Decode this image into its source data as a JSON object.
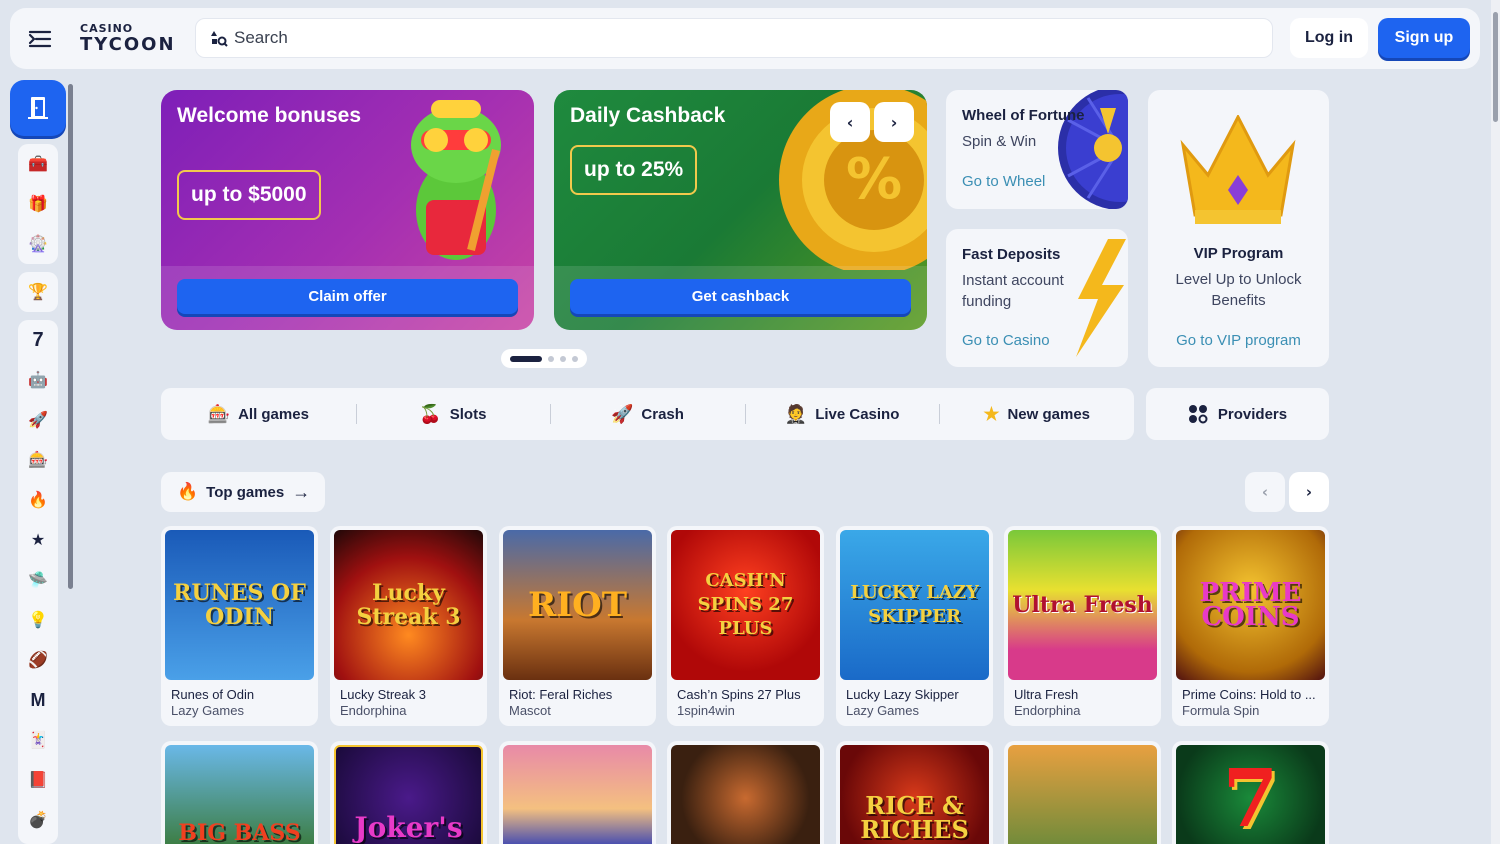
{
  "header": {
    "logo_top": "CASINO",
    "logo_bottom": "TYCOON",
    "search_placeholder": "Search",
    "login_label": "Log in",
    "signup_label": "Sign up"
  },
  "promos": {
    "welcome": {
      "title": "Welcome bonuses",
      "badge": "up to $5000",
      "button": "Claim offer"
    },
    "cashback": {
      "title": "Daily Cashback",
      "badge": "up to 25%",
      "button": "Get cashback"
    }
  },
  "side_cards": {
    "wheel": {
      "title": "Wheel of Fortune",
      "sub": "Spin & Win",
      "link": "Go to Wheel"
    },
    "deposits": {
      "title": "Fast Deposits",
      "sub": "Instant account funding",
      "link": "Go to Casino"
    },
    "vip": {
      "title": "VIP Program",
      "sub": "Level Up to Unlock Benefits",
      "link": "Go to VIP program"
    }
  },
  "categories": [
    {
      "label": "All games",
      "icon": "slot-machine-icon"
    },
    {
      "label": "Slots",
      "icon": "cherries-icon"
    },
    {
      "label": "Crash",
      "icon": "rocket-icon"
    },
    {
      "label": "Live Casino",
      "icon": "dealer-icon"
    },
    {
      "label": "New games",
      "icon": "star-icon"
    }
  ],
  "providers_label": "Providers",
  "top_games_label": "Top games",
  "games": [
    {
      "title": "Runes of Odin",
      "provider": "Lazy Games",
      "art": "RUNES OF ODIN"
    },
    {
      "title": "Lucky Streak 3",
      "provider": "Endorphina",
      "art": "Lucky Streak 3"
    },
    {
      "title": "Riot: Feral Riches",
      "provider": "Mascot",
      "art": "RIOT"
    },
    {
      "title": "Cash’n Spins 27 Plus",
      "provider": "1spin4win",
      "art": "CASH'N SPINS 27 PLUS"
    },
    {
      "title": "Lucky Lazy Skipper",
      "provider": "Lazy Games",
      "art": "LUCKY LAZY SKIPPER"
    },
    {
      "title": "Ultra Fresh",
      "provider": "Endorphina",
      "art": "Ultra Fresh"
    },
    {
      "title": "Prime Coins: Hold to ...",
      "provider": "Formula Spin",
      "art": "PRIME COINS"
    }
  ],
  "games_row2": [
    {
      "art": "BIG BASS"
    },
    {
      "art": "Joker's"
    },
    {
      "art": ""
    },
    {
      "art": ""
    },
    {
      "art": "RICE & RICHES"
    },
    {
      "art": ""
    },
    {
      "art": "7"
    }
  ],
  "colors": {
    "primary": "#1e64f0",
    "link": "#3b8fb4",
    "background": "#dfe5ee",
    "card": "#f4f6fa"
  }
}
